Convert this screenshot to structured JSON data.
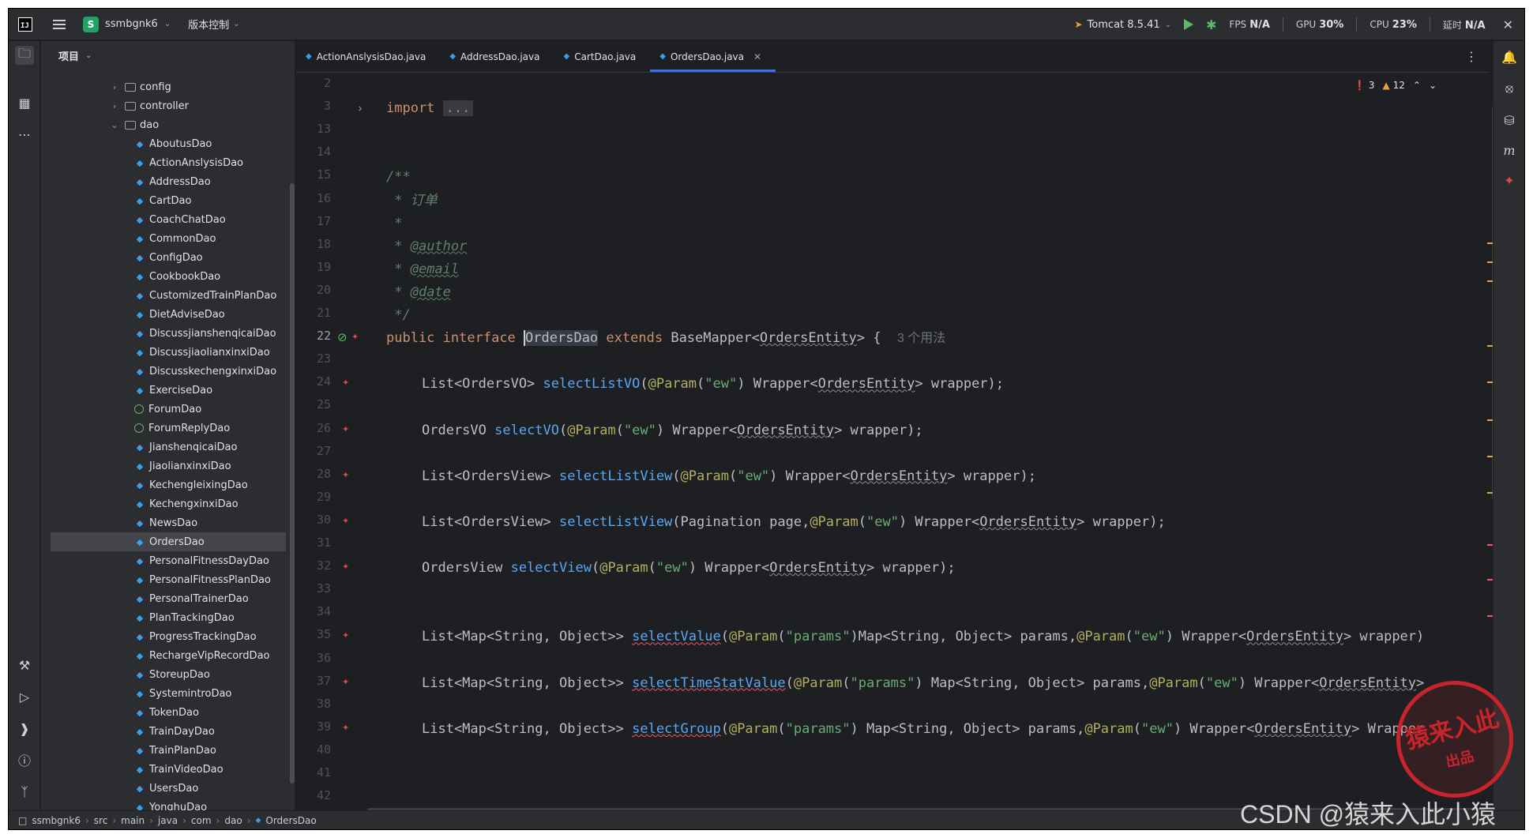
{
  "titlebar": {
    "logo": "IJ",
    "project_badge": "S",
    "project_name": "ssmbgnk6",
    "vcs_label": "版本控制",
    "run_config": "Tomcat 8.5.41",
    "metrics": [
      {
        "label": "FPS",
        "value": "N/A"
      },
      {
        "label": "GPU",
        "value": "30%"
      },
      {
        "label": "CPU",
        "value": "23%"
      },
      {
        "label": "延时",
        "value": "N/A"
      }
    ]
  },
  "project_panel": {
    "title": "项目",
    "tree": [
      {
        "label": "config",
        "kind": "folder",
        "indent": 1,
        "expanded": false
      },
      {
        "label": "controller",
        "kind": "folder",
        "indent": 1,
        "expanded": false
      },
      {
        "label": "dao",
        "kind": "folder",
        "indent": 1,
        "expanded": true
      },
      {
        "label": "AboutusDao",
        "kind": "interface",
        "indent": 2
      },
      {
        "label": "ActionAnslysisDao",
        "kind": "interface",
        "indent": 2
      },
      {
        "label": "AddressDao",
        "kind": "interface",
        "indent": 2
      },
      {
        "label": "CartDao",
        "kind": "interface",
        "indent": 2
      },
      {
        "label": "CoachChatDao",
        "kind": "interface",
        "indent": 2
      },
      {
        "label": "CommonDao",
        "kind": "interface",
        "indent": 2
      },
      {
        "label": "ConfigDao",
        "kind": "interface",
        "indent": 2
      },
      {
        "label": "CookbookDao",
        "kind": "interface",
        "indent": 2
      },
      {
        "label": "CustomizedTrainPlanDao",
        "kind": "interface",
        "indent": 2
      },
      {
        "label": "DietAdviseDao",
        "kind": "interface",
        "indent": 2
      },
      {
        "label": "DiscussjianshenqicaiDao",
        "kind": "interface",
        "indent": 2
      },
      {
        "label": "DiscussjiaolianxinxiDao",
        "kind": "interface",
        "indent": 2
      },
      {
        "label": "DiscusskechengxinxiDao",
        "kind": "interface",
        "indent": 2
      },
      {
        "label": "ExerciseDao",
        "kind": "interface",
        "indent": 2
      },
      {
        "label": "ForumDao",
        "kind": "plain",
        "indent": 2
      },
      {
        "label": "ForumReplyDao",
        "kind": "plain",
        "indent": 2
      },
      {
        "label": "JianshenqicaiDao",
        "kind": "interface",
        "indent": 2
      },
      {
        "label": "JiaolianxinxiDao",
        "kind": "interface",
        "indent": 2
      },
      {
        "label": "KechengleixingDao",
        "kind": "interface",
        "indent": 2
      },
      {
        "label": "KechengxinxiDao",
        "kind": "interface",
        "indent": 2
      },
      {
        "label": "NewsDao",
        "kind": "interface",
        "indent": 2
      },
      {
        "label": "OrdersDao",
        "kind": "interface",
        "indent": 2,
        "selected": true
      },
      {
        "label": "PersonalFitnessDayDao",
        "kind": "interface",
        "indent": 2
      },
      {
        "label": "PersonalFitnessPlanDao",
        "kind": "interface",
        "indent": 2
      },
      {
        "label": "PersonalTrainerDao",
        "kind": "interface",
        "indent": 2
      },
      {
        "label": "PlanTrackingDao",
        "kind": "interface",
        "indent": 2
      },
      {
        "label": "ProgressTrackingDao",
        "kind": "interface",
        "indent": 2
      },
      {
        "label": "RechargeVipRecordDao",
        "kind": "interface",
        "indent": 2
      },
      {
        "label": "StoreupDao",
        "kind": "interface",
        "indent": 2
      },
      {
        "label": "SystemintroDao",
        "kind": "interface",
        "indent": 2
      },
      {
        "label": "TokenDao",
        "kind": "interface",
        "indent": 2
      },
      {
        "label": "TrainDayDao",
        "kind": "interface",
        "indent": 2
      },
      {
        "label": "TrainPlanDao",
        "kind": "interface",
        "indent": 2
      },
      {
        "label": "TrainVideoDao",
        "kind": "interface",
        "indent": 2
      },
      {
        "label": "UsersDao",
        "kind": "interface",
        "indent": 2
      },
      {
        "label": "YonghuDao",
        "kind": "interface",
        "indent": 2
      }
    ]
  },
  "tabs": [
    {
      "label": "ActionAnslysisDao.java",
      "active": false
    },
    {
      "label": "AddressDao.java",
      "active": false
    },
    {
      "label": "CartDao.java",
      "active": false
    },
    {
      "label": "OrdersDao.java",
      "active": true
    }
  ],
  "inspections": {
    "errors": "3",
    "warnings": "12"
  },
  "editor": {
    "line_numbers": [
      "2",
      "3",
      "13",
      "14",
      "15",
      "16",
      "17",
      "18",
      "19",
      "20",
      "21",
      "22",
      "23",
      "24",
      "25",
      "26",
      "27",
      "28",
      "29",
      "30",
      "31",
      "32",
      "33",
      "34",
      "35",
      "36",
      "37",
      "38",
      "39",
      "40",
      "41",
      "42"
    ],
    "current_line": "22",
    "import_kw": "import",
    "import_fold": "...",
    "doc_open": "/**",
    "doc_title": " * 订单",
    "doc_blank": " *",
    "doc_star": " * ",
    "doc_author": "@author",
    "doc_email": "@email",
    "doc_date": "@date",
    "doc_close": " */",
    "decl": {
      "kw1": "public",
      "kw2": "interface",
      "name_pre": "",
      "name": "OrdersDao",
      "kw3": "extends",
      "base": "BaseMapper<",
      "type": "OrdersEntity",
      "end": "> {",
      "hint": "3 个用法"
    },
    "methods": [
      {
        "ret": "List<OrdersVO> ",
        "name": "selectListVO",
        "mark": false,
        "params": [
          [
            "ann",
            "@Param"
          ],
          [
            "txt",
            "("
          ],
          [
            "str",
            "\"ew\""
          ],
          [
            "txt",
            ") Wrapper<"
          ],
          [
            "tp",
            "OrdersEntity"
          ],
          [
            "txt",
            "> wrapper);"
          ]
        ]
      },
      {
        "ret": "OrdersVO ",
        "name": "selectVO",
        "mark": false,
        "params": [
          [
            "ann",
            "@Param"
          ],
          [
            "txt",
            "("
          ],
          [
            "str",
            "\"ew\""
          ],
          [
            "txt",
            ") Wrapper<"
          ],
          [
            "tp",
            "OrdersEntity"
          ],
          [
            "txt",
            "> wrapper);"
          ]
        ]
      },
      {
        "ret": "List<OrdersView> ",
        "name": "selectListView",
        "mark": false,
        "params": [
          [
            "ann",
            "@Param"
          ],
          [
            "txt",
            "("
          ],
          [
            "str",
            "\"ew\""
          ],
          [
            "txt",
            ") Wrapper<"
          ],
          [
            "tp",
            "OrdersEntity"
          ],
          [
            "txt",
            "> wrapper);"
          ]
        ]
      },
      {
        "ret": "List<OrdersView> ",
        "name": "selectListView",
        "mark": false,
        "params": [
          [
            "txt",
            "Pagination page,"
          ],
          [
            "ann",
            "@Param"
          ],
          [
            "txt",
            "("
          ],
          [
            "str",
            "\"ew\""
          ],
          [
            "txt",
            ") Wrapper<"
          ],
          [
            "tp",
            "OrdersEntity"
          ],
          [
            "txt",
            "> wrapper);"
          ]
        ]
      },
      {
        "ret": "OrdersView ",
        "name": "selectView",
        "mark": false,
        "params": [
          [
            "ann",
            "@Param"
          ],
          [
            "txt",
            "("
          ],
          [
            "str",
            "\"ew\""
          ],
          [
            "txt",
            ") Wrapper<"
          ],
          [
            "tp",
            "OrdersEntity"
          ],
          [
            "txt",
            "> wrapper);"
          ]
        ]
      },
      {
        "ret": "List<Map<String, Object>> ",
        "name": "selectValue",
        "mark": true,
        "params": [
          [
            "ann",
            "@Param"
          ],
          [
            "txt",
            "("
          ],
          [
            "str",
            "\"params\""
          ],
          [
            "txt",
            ")Map<String, Object> params,"
          ],
          [
            "ann",
            "@Param"
          ],
          [
            "txt",
            "("
          ],
          [
            "str",
            "\"ew\""
          ],
          [
            "txt",
            ") Wrapper<"
          ],
          [
            "tp",
            "OrdersEntity"
          ],
          [
            "txt",
            "> wrapper)"
          ]
        ]
      },
      {
        "ret": "List<Map<String, Object>> ",
        "name": "selectTimeStatValue",
        "mark": true,
        "params": [
          [
            "ann",
            "@Param"
          ],
          [
            "txt",
            "("
          ],
          [
            "str",
            "\"params\""
          ],
          [
            "txt",
            ") Map<String, Object> params,"
          ],
          [
            "ann",
            "@Param"
          ],
          [
            "txt",
            "("
          ],
          [
            "str",
            "\"ew\""
          ],
          [
            "txt",
            ") Wrapper<"
          ],
          [
            "tp",
            "OrdersEntity"
          ],
          [
            "txt",
            ">"
          ]
        ]
      },
      {
        "ret": "List<Map<String, Object>> ",
        "name": "selectGroup",
        "mark": true,
        "params": [
          [
            "ann",
            "@Param"
          ],
          [
            "txt",
            "("
          ],
          [
            "str",
            "\"params\""
          ],
          [
            "txt",
            ") Map<String, Object> params,"
          ],
          [
            "ann",
            "@Param"
          ],
          [
            "txt",
            "("
          ],
          [
            "str",
            "\"ew\""
          ],
          [
            "txt",
            ") Wrapper<"
          ],
          [
            "tp",
            "OrdersEntity"
          ],
          [
            "txt",
            "> Wrapper"
          ]
        ]
      }
    ]
  },
  "statusbar": {
    "crumbs": [
      "ssmbgnk6",
      "src",
      "main",
      "java",
      "com",
      "dao",
      "OrdersDao"
    ]
  },
  "watermark": {
    "csdn": "CSDN @猿来入此小猿",
    "stamp_line1": "猿来入此",
    "stamp_line2": "出品"
  },
  "colors": {
    "background": "#1e1f22",
    "panel": "#2b2d30",
    "keyword": "#cf8e6d",
    "method": "#56a8f5",
    "annotation": "#b3ae60",
    "string": "#6aab73",
    "comment": "#5f826b",
    "accent": "#3574f0"
  }
}
